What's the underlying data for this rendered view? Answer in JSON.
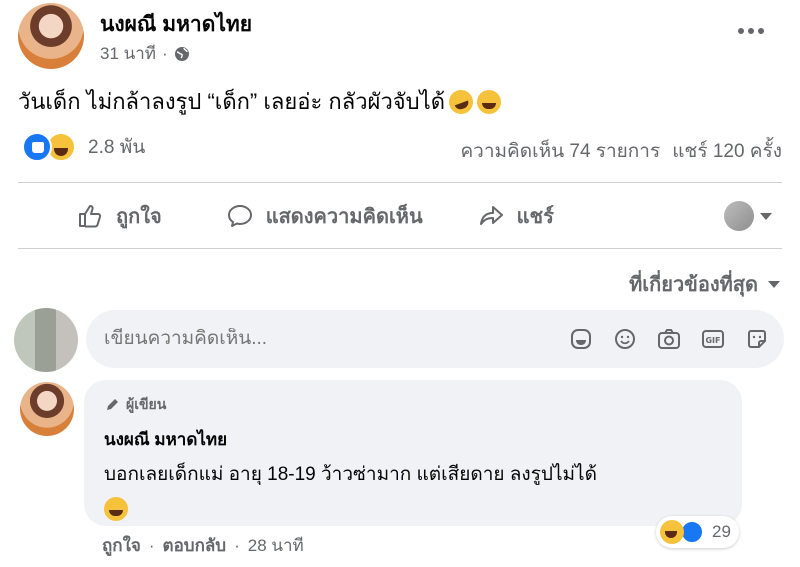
{
  "post": {
    "author": "นงผณี มหาดไทย",
    "time": "31 นาที",
    "separator": "·",
    "text": "วันเด็ก ไม่กล้าลงรูป “เด็ก” เลยอ่ะ กลัวผัวจับได้",
    "reaction_count": "2.8 พัน",
    "comments_count": "ความคิดเห็น 74 รายการ",
    "shares_count": "แชร์ 120 ครั้ง"
  },
  "actions": {
    "like": "ถูกใจ",
    "comment": "แสดงความคิดเห็น",
    "share": "แชร์"
  },
  "sort": {
    "label": "ที่เกี่ยวข้องที่สุด"
  },
  "composer": {
    "placeholder": "เขียนความคิดเห็น..."
  },
  "comment": {
    "badge": "ผู้เขียน",
    "author": "นงผณี มหาดไทย",
    "text": "บอกเลยเด็กแม่ อายุ 18-19 ว้าวซ่ามาก แต่เสียดาย ลงรูปไม่ได้",
    "reaction_count": "29",
    "like_label": "ถูกใจ",
    "separator": "·",
    "reply_label": "ตอบกลับ",
    "time": "28 นาที"
  },
  "colors": {
    "primary_text": "#050505",
    "secondary_text": "#65676b",
    "bubble_bg": "#f0f2f5",
    "like_blue": "#1877f2",
    "haha_yellow": "#f7c23b"
  }
}
